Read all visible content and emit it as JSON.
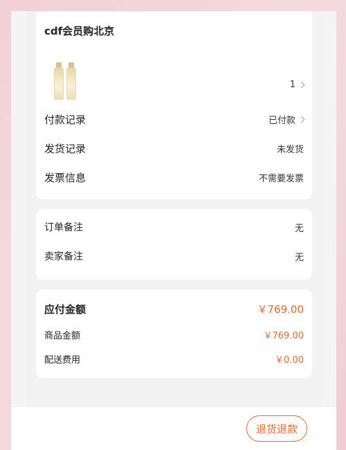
{
  "shop": {
    "name": "cdf会员购北京"
  },
  "product": {
    "quantity": "1",
    "icon": "foundation-bottle-thumbnail"
  },
  "order_rows": [
    {
      "label": "付款记录",
      "value": "已付款",
      "has_arrow": true
    },
    {
      "label": "发货记录",
      "value": "未发货",
      "has_arrow": false
    },
    {
      "label": "发票信息",
      "value": "不需要发票",
      "has_arrow": false
    }
  ],
  "notes": [
    {
      "label": "订单备注",
      "value": "无"
    },
    {
      "label": "卖家备注",
      "value": "无"
    }
  ],
  "amount": {
    "payable_label": "应付金额",
    "payable_value": "￥769.00",
    "goods_label": "商品金额",
    "goods_value": "￥769.00",
    "shipping_label": "配送费用",
    "shipping_value": "￥0.00"
  },
  "actions": {
    "refund_label": "退货退款"
  },
  "colors": {
    "accent": "#e2682b",
    "background": "#f2f2f2",
    "card": "#ffffff"
  }
}
